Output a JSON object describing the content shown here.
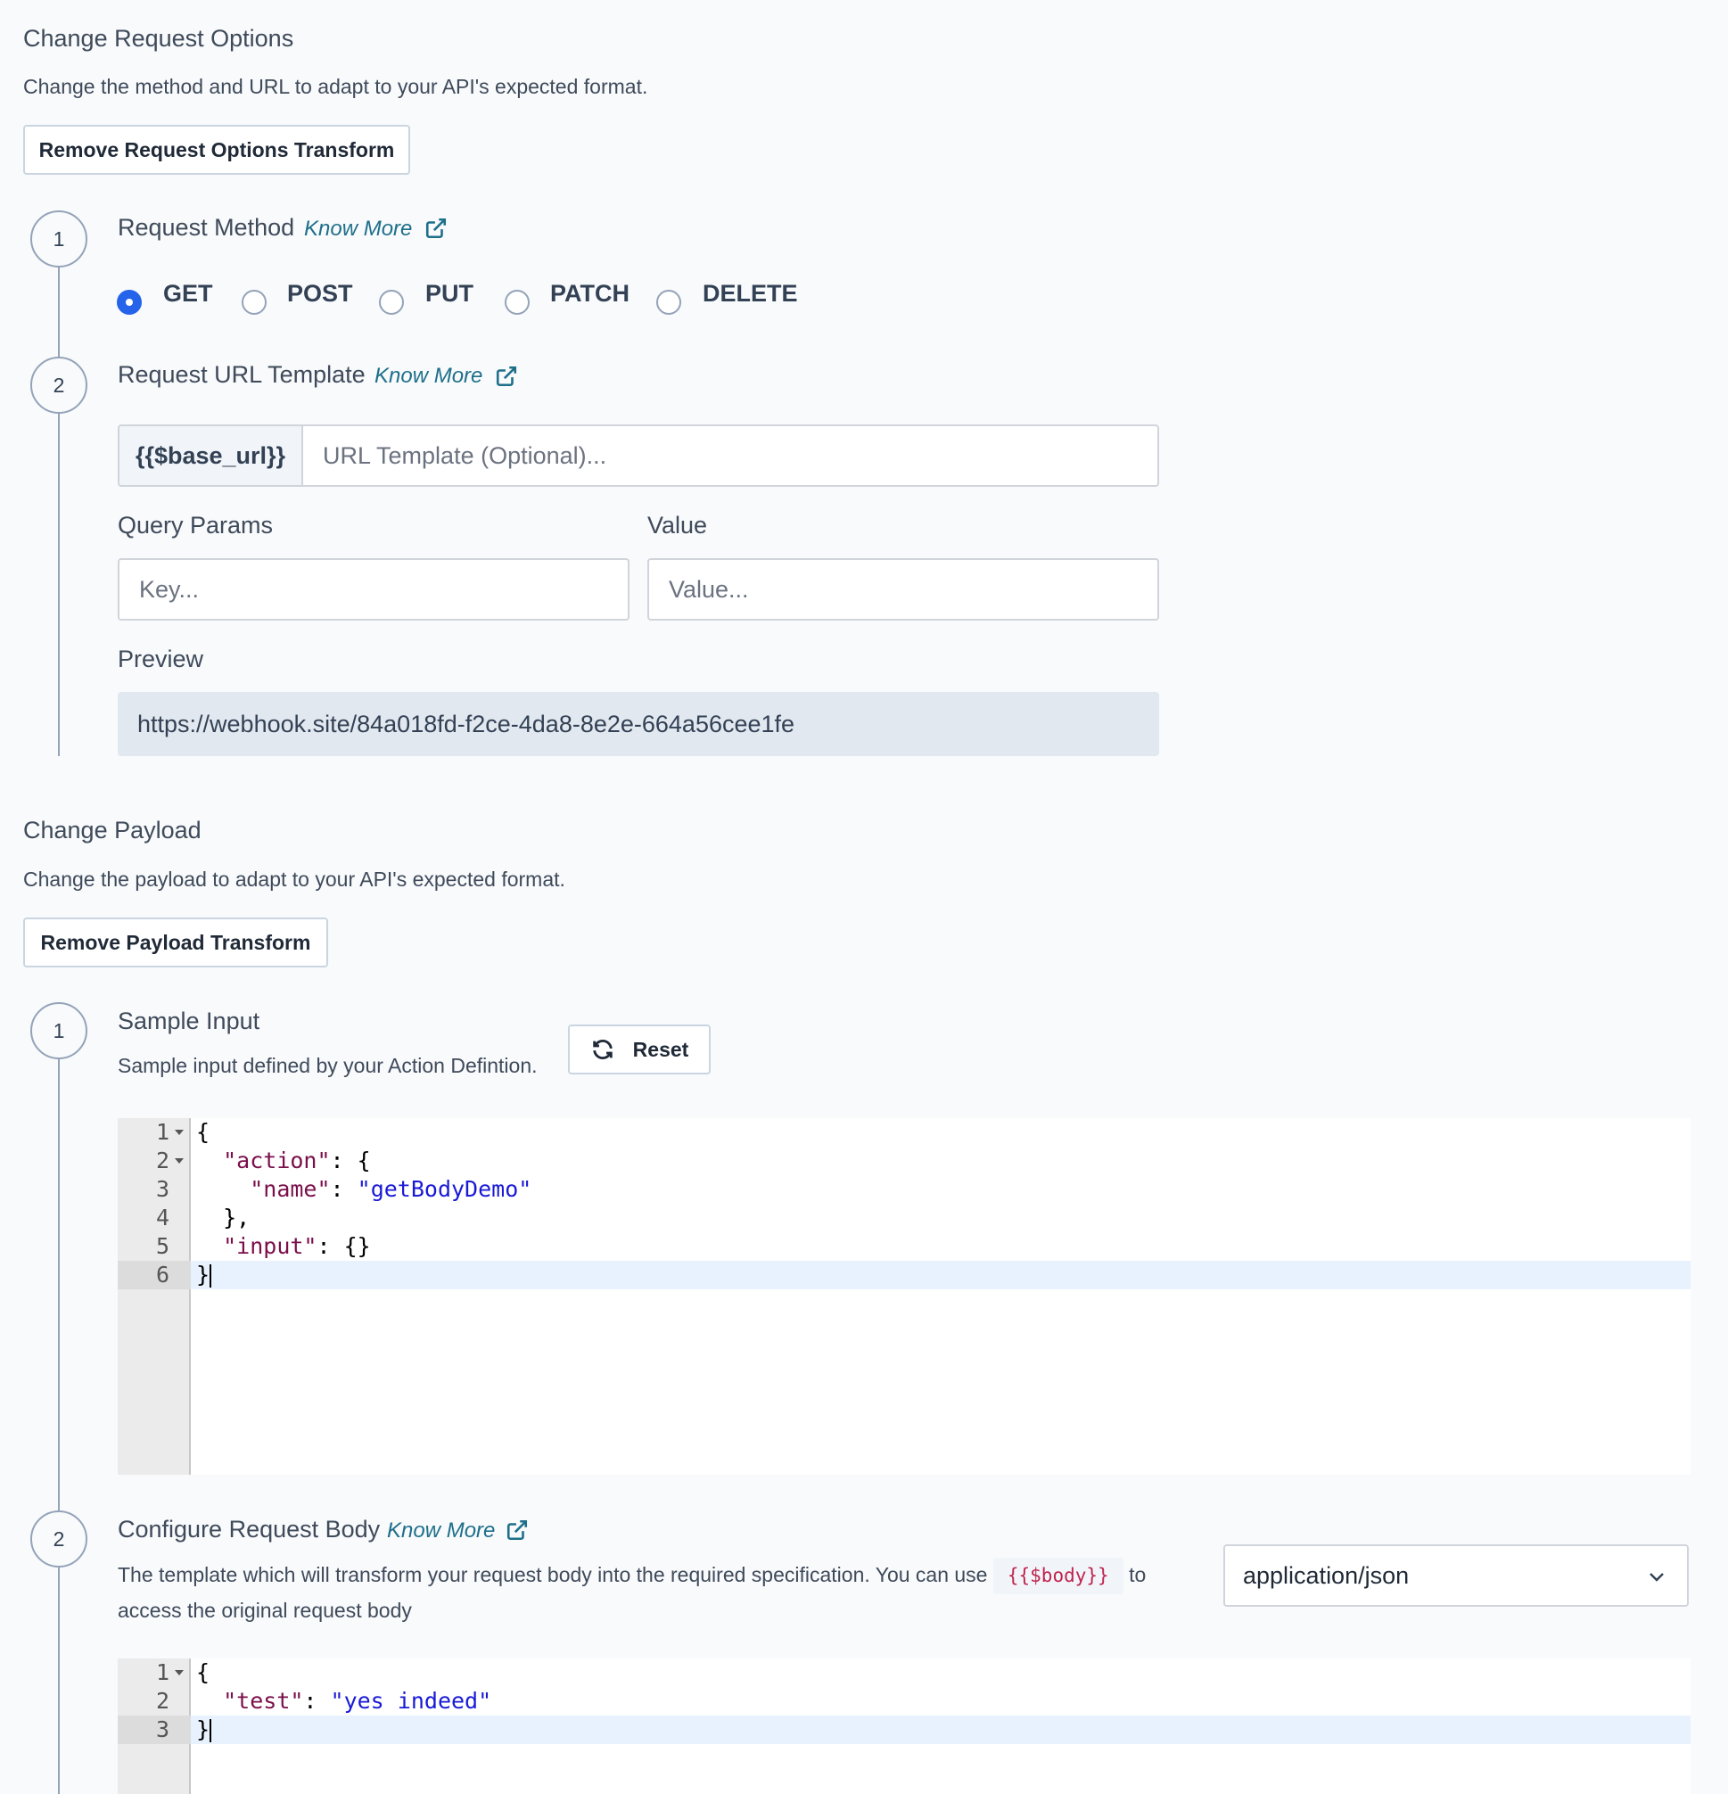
{
  "request_options": {
    "title": "Change Request Options",
    "description": "Change the method and URL to adapt to your API's expected format.",
    "remove_button": "Remove Request Options Transform",
    "step1": {
      "number": "1",
      "title": "Request Method",
      "know_more": "Know More",
      "methods": [
        "GET",
        "POST",
        "PUT",
        "PATCH",
        "DELETE"
      ],
      "selected": "GET"
    },
    "step2": {
      "number": "2",
      "title": "Request URL Template",
      "know_more": "Know More",
      "url_prefix": "{{$base_url}}",
      "url_placeholder": "URL Template (Optional)...",
      "query_params_label": "Query Params",
      "value_label": "Value",
      "key_placeholder": "Key...",
      "value_placeholder": "Value...",
      "preview_label": "Preview",
      "preview_value": "https://webhook.site/84a018fd-f2ce-4da8-8e2e-664a56cee1fe"
    }
  },
  "payload": {
    "title": "Change Payload",
    "description": "Change the payload to adapt to your API's expected format.",
    "remove_button": "Remove Payload Transform",
    "step1": {
      "number": "1",
      "title": "Sample Input",
      "description": "Sample input defined by your Action Defintion.",
      "reset_button": "Reset",
      "editor_lines": [
        {
          "n": "1",
          "text": "{"
        },
        {
          "n": "2",
          "key": "\"action\"",
          "rest": ": {"
        },
        {
          "n": "3",
          "key": "\"name\"",
          "sep": ": ",
          "str": "\"getBodyDemo\""
        },
        {
          "n": "4",
          "text": "},"
        },
        {
          "n": "5",
          "key": "\"input\"",
          "rest": ": {}"
        },
        {
          "n": "6",
          "text": "}"
        }
      ]
    },
    "step2": {
      "number": "2",
      "title": "Configure Request Body",
      "know_more": "Know More",
      "description_before": "The template which will transform your request body into the required specification. You can use",
      "inline_code": "{{$body}}",
      "description_after": "to",
      "description_line2": "access the original request body",
      "content_type": "application/json",
      "editor_lines": [
        {
          "n": "1",
          "text": "{"
        },
        {
          "n": "2",
          "key": "\"test\"",
          "sep": ": ",
          "str": "\"yes indeed\""
        },
        {
          "n": "3",
          "text": "}"
        }
      ]
    }
  },
  "colors": {
    "background": "#f8fafc",
    "accent_blue": "#2563eb",
    "link_teal": "#1e6f8a",
    "json_key": "#7a0f4a",
    "json_string": "#1a1ad6"
  },
  "icons": {
    "know_more": "external-link-icon",
    "reset": "refresh-icon",
    "select": "chevron-down-icon"
  }
}
